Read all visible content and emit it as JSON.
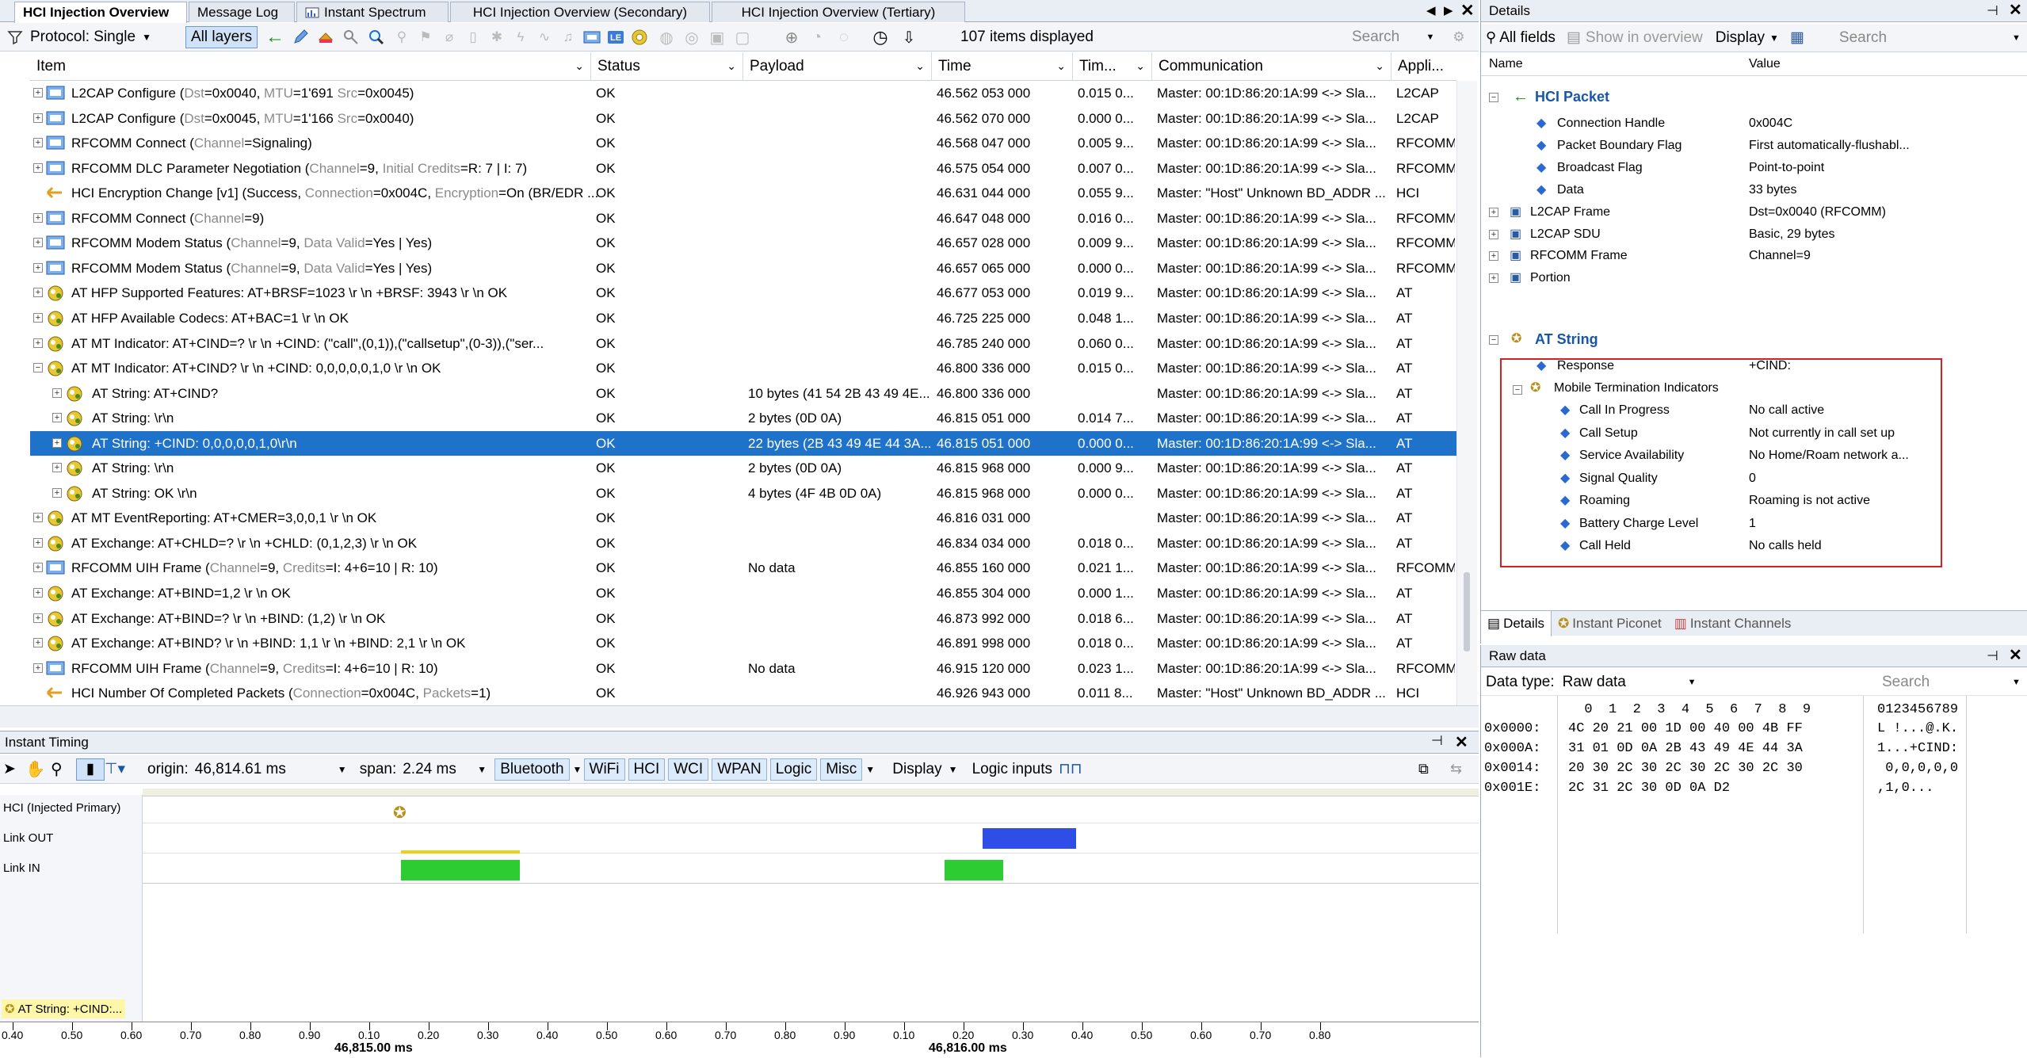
{
  "tabs": [
    {
      "label": "HCI Injection Overview",
      "active": true
    },
    {
      "label": "Message Log"
    },
    {
      "label": "Instant Spectrum"
    },
    {
      "label": "HCI Injection Overview (Secondary)"
    },
    {
      "label": "HCI Injection Overview (Tertiary)"
    }
  ],
  "toolbar": {
    "protocol_label": "Protocol: Single",
    "layers_label": "All layers",
    "items_displayed": "107 items displayed",
    "search_placeholder": "Search"
  },
  "columns": {
    "item": "Item",
    "status": "Status",
    "payload": "Payload",
    "time": "Time",
    "timdelta": "Tim...",
    "communication": "Communication",
    "application": "Appli..."
  },
  "rows": [
    {
      "item": "L2CAP Configure (",
      "k1": "Dst",
      "v1": "=0x0040, ",
      "k2": "MTU",
      "v2": "=1'691 ",
      "k3": "Src",
      "v3": "=0x0045)",
      "status": "OK",
      "payload": "",
      "time": "46.562 053 000",
      "td": "0.015 0...",
      "comm": "Master: 00:1D:86:20:1A:99 <-> Sla...",
      "app": "L2CAP",
      "icon": "plus"
    },
    {
      "item": "L2CAP Configure (",
      "k1": "Dst",
      "v1": "=0x0045, ",
      "k2": "MTU",
      "v2": "=1'166 ",
      "k3": "Src",
      "v3": "=0x0040)",
      "status": "OK",
      "payload": "",
      "time": "46.562 070 000",
      "td": "0.000 0...",
      "comm": "Master: 00:1D:86:20:1A:99 <-> Sla...",
      "app": "L2CAP",
      "icon": "plus"
    },
    {
      "item": "RFCOMM Connect (",
      "k1": "Channel",
      "v1": "=Signaling)",
      "status": "OK",
      "payload": "",
      "time": "46.568 047 000",
      "td": "0.005 9...",
      "comm": "Master: 00:1D:86:20:1A:99 <-> Sla...",
      "app": "RFCOMM",
      "icon": "plus"
    },
    {
      "item": "RFCOMM DLC Parameter Negotiation (",
      "k1": "Channel",
      "v1": "=9, ",
      "k2": "Initial Credits",
      "v2": "=R: 7 | I: 7)",
      "status": "OK",
      "payload": "",
      "time": "46.575 054 000",
      "td": "0.007 0...",
      "comm": "Master: 00:1D:86:20:1A:99 <-> Sla...",
      "app": "RFCOMM",
      "icon": "plus"
    },
    {
      "item": "HCI Encryption Change [v1] (Success, ",
      "k1": "Connection",
      "v1": "=0x004C, ",
      "k2": "Encryption",
      "v2": "=On (BR/EDR ...",
      "status": "OK",
      "payload": "",
      "time": "46.631 044 000",
      "td": "0.055 9...",
      "comm": "Master: \"Host\" Unknown BD_ADDR ...",
      "app": "HCI",
      "icon": "arrow"
    },
    {
      "item": "RFCOMM Connect (",
      "k1": "Channel",
      "v1": "=9)",
      "status": "OK",
      "payload": "",
      "time": "46.647 048 000",
      "td": "0.016 0...",
      "comm": "Master: 00:1D:86:20:1A:99 <-> Sla...",
      "app": "RFCOMM",
      "icon": "plus"
    },
    {
      "item": "RFCOMM Modem Status (",
      "k1": "Channel",
      "v1": "=9, ",
      "k2": "Data Valid",
      "v2": "=Yes | Yes)",
      "status": "OK",
      "payload": "",
      "time": "46.657 028 000",
      "td": "0.009 9...",
      "comm": "Master: 00:1D:86:20:1A:99 <-> Sla...",
      "app": "RFCOMM",
      "icon": "plus"
    },
    {
      "item": "RFCOMM Modem Status (",
      "k1": "Channel",
      "v1": "=9, ",
      "k2": "Data Valid",
      "v2": "=Yes | Yes)",
      "status": "OK",
      "payload": "",
      "time": "46.657 065 000",
      "td": "0.000 0...",
      "comm": "Master: 00:1D:86:20:1A:99 <-> Sla...",
      "app": "RFCOMM",
      "icon": "plus"
    },
    {
      "item": "AT HFP Supported Features: AT+BRSF=1023 \\r \\n +BRSF: 3943 \\r \\n OK",
      "status": "OK",
      "payload": "",
      "time": "46.677 053 000",
      "td": "0.019 9...",
      "comm": "Master: 00:1D:86:20:1A:99 <-> Sla...",
      "app": "AT",
      "icon": "plus"
    },
    {
      "item": "AT HFP Available Codecs: AT+BAC=1 \\r \\n OK",
      "status": "OK",
      "payload": "",
      "time": "46.725 225 000",
      "td": "0.048 1...",
      "comm": "Master: 00:1D:86:20:1A:99 <-> Sla...",
      "app": "AT",
      "icon": "plus"
    },
    {
      "item": "AT MT Indicator: AT+CIND=? \\r \\n +CIND: (\"call\",(0,1)),(\"callsetup\",(0-3)),(\"ser...",
      "status": "OK",
      "payload": "",
      "time": "46.785 240 000",
      "td": "0.060 0...",
      "comm": "Master: 00:1D:86:20:1A:99 <-> Sla...",
      "app": "AT",
      "icon": "plus"
    },
    {
      "item": "AT MT Indicator: AT+CIND? \\r \\n +CIND: 0,0,0,0,0,1,0 \\r \\n OK",
      "status": "OK",
      "payload": "",
      "time": "46.800 336 000",
      "td": "0.015 0...",
      "comm": "Master: 00:1D:86:20:1A:99 <-> Sla...",
      "app": "AT",
      "icon": "minus"
    },
    {
      "item": "AT String: AT+CIND?",
      "status": "OK",
      "payload": "10 bytes (41 54 2B 43 49 4E...",
      "time": "46.800 336 000",
      "td": "",
      "comm": "Master: 00:1D:86:20:1A:99 <-> Sla...",
      "app": "AT",
      "icon": "child"
    },
    {
      "item": "AT String: \\r\\n",
      "status": "OK",
      "payload": "2 bytes (0D 0A)",
      "time": "46.815 051 000",
      "td": "0.014 7...",
      "comm": "Master: 00:1D:86:20:1A:99 <-> Sla...",
      "app": "AT",
      "icon": "child"
    },
    {
      "item": "AT String: +CIND: 0,0,0,0,0,1,0\\r\\n",
      "status": "OK",
      "payload": "22 bytes (2B 43 49 4E 44 3A...",
      "time": "46.815 051 000",
      "td": "0.000 0...",
      "comm": "Master: 00:1D:86:20:1A:99 <-> Sla...",
      "app": "AT",
      "icon": "child",
      "selected": true
    },
    {
      "item": "AT String: \\r\\n",
      "status": "OK",
      "payload": "2 bytes (0D 0A)",
      "time": "46.815 968 000",
      "td": "0.000 9...",
      "comm": "Master: 00:1D:86:20:1A:99 <-> Sla...",
      "app": "AT",
      "icon": "child"
    },
    {
      "item": "AT String: OK \\r\\n",
      "status": "OK",
      "payload": "4 bytes (4F 4B 0D 0A)",
      "time": "46.815 968 000",
      "td": "0.000 0...",
      "comm": "Master: 00:1D:86:20:1A:99 <-> Sla...",
      "app": "AT",
      "icon": "child"
    },
    {
      "item": "AT MT EventReporting: AT+CMER=3,0,0,1 \\r \\n OK",
      "status": "OK",
      "payload": "",
      "time": "46.816 031 000",
      "td": "",
      "comm": "Master: 00:1D:86:20:1A:99 <-> Sla...",
      "app": "AT",
      "icon": "plus"
    },
    {
      "item": "AT Exchange: AT+CHLD=? \\r \\n +CHLD: (0,1,2,3) \\r \\n OK",
      "status": "OK",
      "payload": "",
      "time": "46.834 034 000",
      "td": "0.018 0...",
      "comm": "Master: 00:1D:86:20:1A:99 <-> Sla...",
      "app": "AT",
      "icon": "plus"
    },
    {
      "item": "RFCOMM UIH Frame (",
      "k1": "Channel",
      "v1": "=9, ",
      "k2": "Credits",
      "v2": "=I: 4+6=10 | R: 10)",
      "status": "OK",
      "payload": "No data",
      "time": "46.855 160 000",
      "td": "0.021 1...",
      "comm": "Master: 00:1D:86:20:1A:99 <-> Sla...",
      "app": "RFCOMM",
      "icon": "plus"
    },
    {
      "item": "AT Exchange: AT+BIND=1,2 \\r \\n OK",
      "status": "OK",
      "payload": "",
      "time": "46.855 304 000",
      "td": "0.000 1...",
      "comm": "Master: 00:1D:86:20:1A:99 <-> Sla...",
      "app": "AT",
      "icon": "plus"
    },
    {
      "item": "AT Exchange: AT+BIND=? \\r \\n +BIND: (1,2) \\r \\n OK",
      "status": "OK",
      "payload": "",
      "time": "46.873 992 000",
      "td": "0.018 6...",
      "comm": "Master: 00:1D:86:20:1A:99 <-> Sla...",
      "app": "AT",
      "icon": "plus"
    },
    {
      "item": "AT Exchange: AT+BIND? \\r \\n +BIND: 1,1 \\r \\n +BIND: 2,1 \\r \\n OK",
      "status": "OK",
      "payload": "",
      "time": "46.891 998 000",
      "td": "0.018 0...",
      "comm": "Master: 00:1D:86:20:1A:99 <-> Sla...",
      "app": "AT",
      "icon": "plus"
    },
    {
      "item": "RFCOMM UIH Frame (",
      "k1": "Channel",
      "v1": "=9, ",
      "k2": "Credits",
      "v2": "=I: 4+6=10 | R: 10)",
      "status": "OK",
      "payload": "No data",
      "time": "46.915 120 000",
      "td": "0.023 1...",
      "comm": "Master: 00:1D:86:20:1A:99 <-> Sla...",
      "app": "RFCOMM",
      "icon": "plus"
    },
    {
      "item": "HCI Number Of Completed Packets (",
      "k1": "Connection",
      "v1": "=0x004C, ",
      "k2": "Packets",
      "v2": "=1)",
      "status": "OK",
      "payload": "",
      "time": "46.926 943 000",
      "td": "0.011 8...",
      "comm": "Master: \"Host\" Unknown BD_ADDR ...",
      "app": "HCI",
      "icon": "arrow"
    }
  ],
  "details": {
    "title": "Details",
    "toolbar": {
      "all_fields": "All fields",
      "show_overview": "Show in overview",
      "display": "Display",
      "search": "Search"
    },
    "col_name": "Name",
    "col_value": "Value",
    "hci_packet": "HCI Packet",
    "fields": [
      {
        "name": "Connection Handle",
        "value": "0x004C"
      },
      {
        "name": "Packet Boundary Flag",
        "value": "First automatically-flushabl..."
      },
      {
        "name": "Broadcast Flag",
        "value": "Point-to-point"
      },
      {
        "name": "Data",
        "value": "33 bytes"
      }
    ],
    "groups": [
      {
        "name": "L2CAP Frame",
        "value": "Dst=0x0040 (RFCOMM)"
      },
      {
        "name": "L2CAP SDU",
        "value": "Basic, 29 bytes"
      },
      {
        "name": "RFCOMM Frame",
        "value": "Channel=9"
      },
      {
        "name": "Portion",
        "value": ""
      }
    ],
    "at_string": "AT String",
    "response": {
      "name": "Response",
      "value": "+CIND:"
    },
    "mti": "Mobile Termination Indicators",
    "indicators": [
      {
        "name": "Call In Progress",
        "value": "No call active"
      },
      {
        "name": "Call Setup",
        "value": "Not currently in call set up"
      },
      {
        "name": "Service Availability",
        "value": "No Home/Roam network a..."
      },
      {
        "name": "Signal Quality",
        "value": "0"
      },
      {
        "name": "Roaming",
        "value": "Roaming is not active"
      },
      {
        "name": "Battery Charge Level",
        "value": "1"
      },
      {
        "name": "Call Held",
        "value": "No calls held"
      }
    ],
    "bottom_tabs": [
      "Details",
      "Instant Piconet",
      "Instant Channels"
    ],
    "highlight_color": "#d62020"
  },
  "raw": {
    "title": "Raw data",
    "datatype_label": "Data type:",
    "datatype": "Raw data",
    "search": "Search",
    "header_cols": "  0  1  2  3  4  5  6  7  8  9",
    "header_ascii": "0123456789",
    "lines": [
      {
        "addr": "0x0000:",
        "hex": "4C 20 21 00 1D 00 40 00 4B FF",
        "ascii": "L !...@.K."
      },
      {
        "addr": "0x000A:",
        "hex": "31 01 0D 0A 2B 43 49 4E 44 3A",
        "ascii": "1...+CIND:"
      },
      {
        "addr": "0x0014:",
        "hex": "20 30 2C 30 2C 30 2C 30 2C 30",
        " ascii": "",
        "ascii": " 0,0,0,0,0"
      },
      {
        "addr": "0x001E:",
        "hex": "2C 31 2C 30 0D 0A D2",
        "ascii": ",1,0..."
      }
    ]
  },
  "timing": {
    "title": "Instant Timing",
    "origin_label": "origin:",
    "origin": "46,814.61 ms",
    "span_label": "span:",
    "span": "2.24 ms",
    "chips": [
      "Bluetooth",
      "WiFi",
      "HCI",
      "WCI",
      "WPAN",
      "Logic",
      "Misc"
    ],
    "display": "Display",
    "logic_inputs": "Logic inputs",
    "lanes": [
      "HCI (Injected Primary)",
      "Link OUT",
      "Link IN"
    ],
    "bottom_label": "AT String: +CIND:...",
    "ticks1": [
      "0.40",
      "0.50",
      "0.60",
      "0.70",
      "0.80",
      "0.90",
      "0.10",
      "0.20",
      "0.30",
      "0.40",
      "0.50",
      "0.60",
      "0.70",
      "0.80",
      "0.90",
      "0.10",
      "0.20",
      "0.30",
      "0.40",
      "0.50",
      "0.60",
      "0.70",
      "0.80"
    ],
    "major1": "46,815.00",
    "major2": "46,816.00",
    "unit": "ms",
    "colors": {
      "out": "#2f4ee8",
      "in": "#2dcc32",
      "yellow": "#e8d21a"
    }
  }
}
